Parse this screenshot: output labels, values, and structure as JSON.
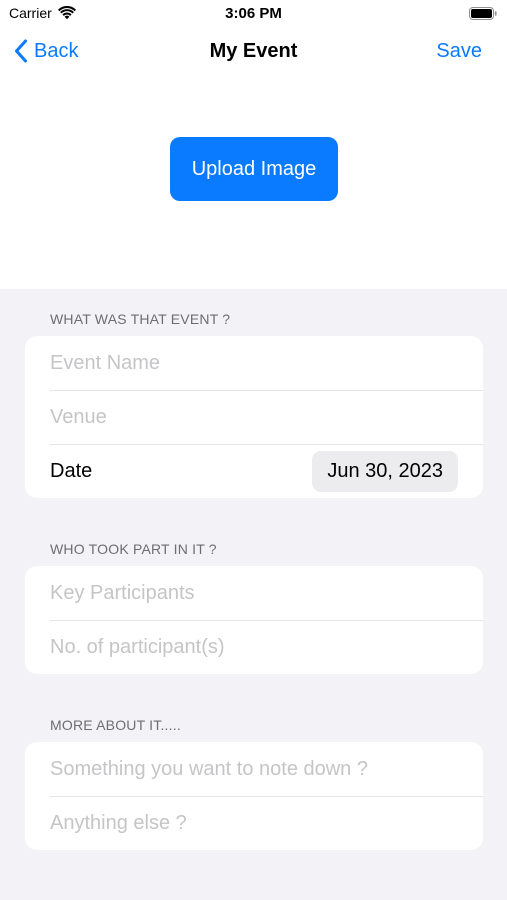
{
  "status_bar": {
    "carrier": "Carrier",
    "time": "3:06 PM",
    "wifi_icon": "wifi-icon",
    "battery_icon": "battery-icon"
  },
  "nav": {
    "back_label": "Back",
    "back_icon": "chevron-left-icon",
    "title": "My Event",
    "save_label": "Save",
    "accent_color": "#0a7aff"
  },
  "upload": {
    "label": "Upload Image",
    "color": "#0a7aff"
  },
  "sections": {
    "event": {
      "header": "WHAT WAS THAT EVENT ?",
      "name_placeholder": "Event Name",
      "venue_placeholder": "Venue",
      "date_label": "Date",
      "date_value": "Jun 30, 2023"
    },
    "participants": {
      "header": "WHO TOOK PART IN IT ?",
      "key_placeholder": "Key Participants",
      "count_placeholder": "No. of participant(s)"
    },
    "more": {
      "header": "MORE ABOUT IT.....",
      "note_placeholder": "Something you want to note down ?",
      "else_placeholder": "Anything else ?"
    }
  },
  "colors": {
    "form_background": "#f2f2f7",
    "card_background": "#ffffff",
    "placeholder_text": "#c5c5c8",
    "section_header_text": "#6d6d72"
  }
}
